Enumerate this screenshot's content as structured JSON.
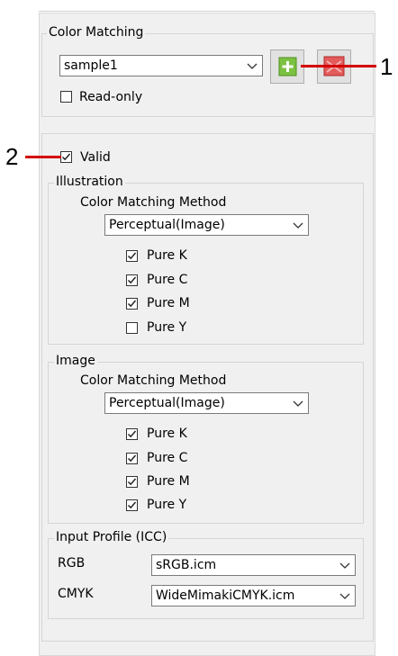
{
  "color_matching": {
    "legend": "Color Matching",
    "profile_value": "sample1",
    "read_only_label": "Read-only",
    "read_only_checked": false,
    "add_icon": "plus-icon",
    "delete_icon": "delete-icon"
  },
  "settings": {
    "valid_label": "Valid",
    "valid_checked": true,
    "illustration": {
      "legend": "Illustration",
      "method_label": "Color Matching Method",
      "method_value": "Perceptual(Image)",
      "options": [
        {
          "label": "Pure K",
          "checked": true
        },
        {
          "label": "Pure C",
          "checked": true
        },
        {
          "label": "Pure M",
          "checked": true
        },
        {
          "label": "Pure Y",
          "checked": false
        }
      ]
    },
    "image": {
      "legend": "Image",
      "method_label": "Color Matching Method",
      "method_value": "Perceptual(Image)",
      "options": [
        {
          "label": "Pure K",
          "checked": true
        },
        {
          "label": "Pure C",
          "checked": true
        },
        {
          "label": "Pure M",
          "checked": true
        },
        {
          "label": "Pure Y",
          "checked": true
        }
      ]
    },
    "input_profile": {
      "legend": "Input Profile (ICC)",
      "rgb_label": "RGB",
      "rgb_value": "sRGB.icm",
      "cmyk_label": "CMYK",
      "cmyk_value": "WideMimakiCMYK.icm"
    }
  },
  "callouts": {
    "one": "1",
    "two": "2"
  },
  "colors": {
    "panel_bg": "#f0f0f0",
    "add_button": "#7cc242",
    "delete_button": "#e35b5b",
    "callout_line": "#d40000"
  }
}
